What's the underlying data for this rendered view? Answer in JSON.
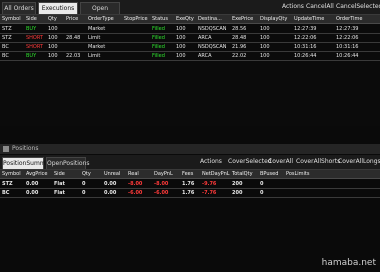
{
  "top_tabs": [
    "All Orders",
    "Executions",
    "Open Orders"
  ],
  "top_menu": [
    "Actions",
    "CancelAll",
    "CancelSelected"
  ],
  "exec_headers": [
    "Symbol",
    "Side",
    "Qty",
    "Price",
    "OrderType",
    "StopPrice",
    "Status",
    "ExeQty",
    "Destina...",
    "ExePrice",
    "DisplayQty",
    "UpdateTime",
    "OrderTime"
  ],
  "exec_rows": [
    [
      "STZ",
      "BUY",
      "100",
      "",
      "Market",
      "",
      "Filled",
      "100",
      "NSDQSCAN",
      "28.56",
      "100",
      "12:27:39",
      "12:27:39"
    ],
    [
      "STZ",
      "SHORT",
      "100",
      "28.48",
      "Limit",
      "",
      "Filled",
      "100",
      "ARCA",
      "28.48",
      "100",
      "12:22:06",
      "12:22:06"
    ],
    [
      "BC",
      "SHORT",
      "100",
      "",
      "Market",
      "",
      "Filled",
      "100",
      "NSDQSCAN",
      "21.96",
      "100",
      "10:31:16",
      "10:31:16"
    ],
    [
      "BC",
      "BUY",
      "100",
      "22.03",
      "Limit",
      "",
      "Filled",
      "100",
      "ARCA",
      "22.02",
      "100",
      "10:26:44",
      "10:26:44"
    ]
  ],
  "bottom_title": "Positions",
  "bottom_tabs": [
    "PositionSummary",
    "OpenPositions"
  ],
  "bottom_menu": [
    "Actions",
    "CoverSelected",
    "CoverAll",
    "CoverAllShorts",
    "CoverAllLongs"
  ],
  "pos_headers": [
    "Symbol",
    "AvgPrice",
    "Side",
    "Qty",
    "Unreal",
    "Real",
    "DayPnL",
    "Fees",
    "NetDayPnL",
    "TotalQty",
    "BPused",
    "PosLimits"
  ],
  "pos_rows": [
    [
      "STZ",
      "0.00",
      "Flat",
      "0",
      "0.00",
      "-8.00",
      "-8.00",
      "1.76",
      "-9.76",
      "200",
      "0",
      ""
    ],
    [
      "BC",
      "0.00",
      "Flat",
      "0",
      "0.00",
      "-6.00",
      "-6.00",
      "1.76",
      "-7.76",
      "200",
      "0",
      ""
    ]
  ],
  "watermark": "hamaba.net"
}
